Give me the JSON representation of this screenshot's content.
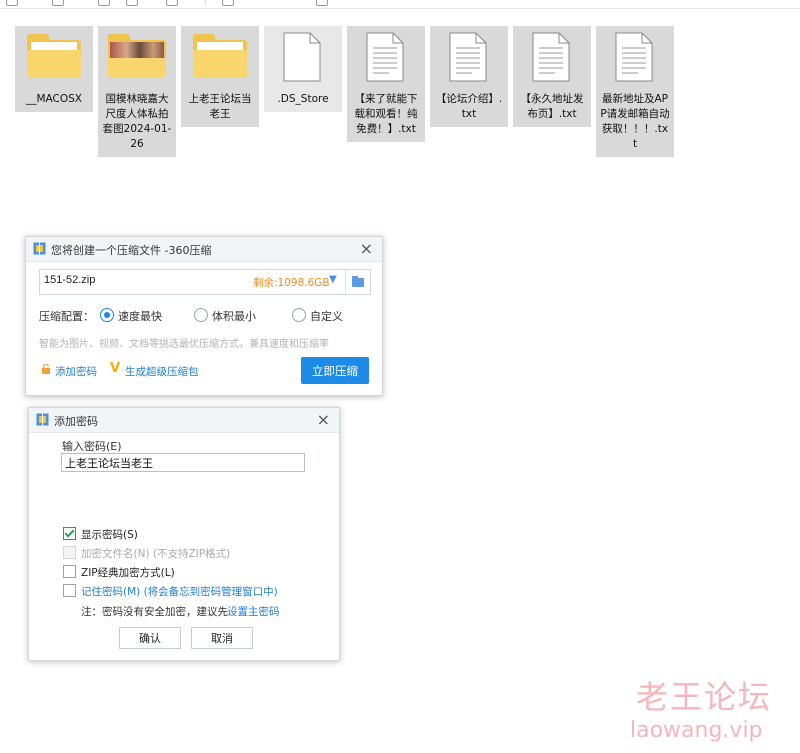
{
  "files": [
    {
      "name": "__MACOSX",
      "icon": "folder-icon"
    },
    {
      "name": "国模林晓嘉大尺度人体私拍套图2024-01-26",
      "icon": "photo-folder-icon"
    },
    {
      "name": "上老王论坛当老王",
      "icon": "folder-icon"
    },
    {
      "name": ".DS_Store",
      "icon": "file-icon"
    },
    {
      "name": "【来了就能下载和观看！纯免费！】.txt",
      "icon": "text-file-icon"
    },
    {
      "name": "【论坛介绍】.txt",
      "icon": "text-file-icon"
    },
    {
      "name": "【永久地址发布页】.txt",
      "icon": "text-file-icon"
    },
    {
      "name": "最新地址及APP请发邮箱自动获取！！！.txt",
      "icon": "text-file-icon"
    }
  ],
  "compress_dialog": {
    "title": "您将创建一个压缩文件 -360压缩",
    "filename": "151-52.zip",
    "free_space": "剩余:1098.6GB",
    "config_label": "压缩配置：",
    "options": [
      "速度最快",
      "体积最小",
      "自定义"
    ],
    "selected_option": "速度最快",
    "hint": "智能为图片、视频、文档等挑选最优压缩方式，兼具速度和压缩率",
    "add_password": "添加密码",
    "super_compress": "生成超级压缩包",
    "compress_now": "立即压缩"
  },
  "password_dialog": {
    "title": "添加密码",
    "input_label": "输入密码(E)",
    "password_value": "上老王论坛当老王",
    "checkboxes": [
      {
        "label": "显示密码(S)",
        "checked": true,
        "disabled": false
      },
      {
        "label": "加密文件名(N) (不支持ZIP格式)",
        "checked": false,
        "disabled": true
      },
      {
        "label": "ZIP经典加密方式(L)",
        "checked": false,
        "disabled": false
      },
      {
        "label": "记住密码(M) (将会备忘到密码管理窗口中)",
        "checked": false,
        "disabled": false
      }
    ],
    "note": "注：密码没有安全加密，建议先",
    "note_link": "设置主密码",
    "ok": "确认",
    "cancel": "取消"
  },
  "watermark": {
    "line1": "老王论坛",
    "line2": "laowang.vip"
  },
  "colors": {
    "accent": "#1e8ae8",
    "folder": "#f1c44e",
    "selection": "#d9d9d9",
    "warning": "#f08c1e"
  }
}
